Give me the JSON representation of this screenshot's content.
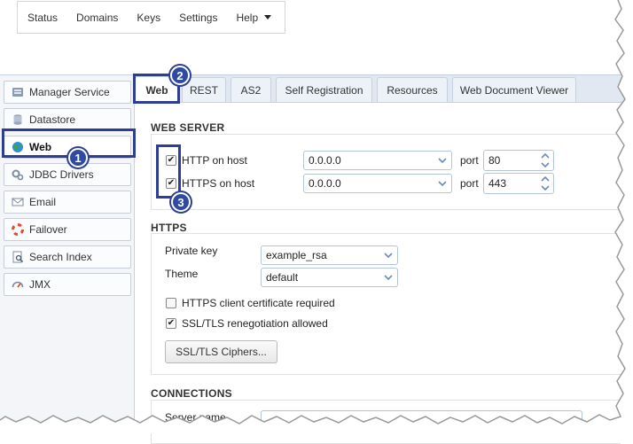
{
  "topmenu": {
    "items": [
      "Status",
      "Domains",
      "Keys",
      "Settings"
    ],
    "help_label": "Help"
  },
  "sidebar": {
    "items": [
      {
        "label": "Manager Service",
        "icon": "manager-service-icon"
      },
      {
        "label": "Datastore",
        "icon": "database-icon"
      },
      {
        "label": "Web",
        "icon": "globe-icon"
      },
      {
        "label": "JDBC Drivers",
        "icon": "gears-icon"
      },
      {
        "label": "Email",
        "icon": "envelope-icon"
      },
      {
        "label": "Failover",
        "icon": "lifebuoy-icon"
      },
      {
        "label": "Search Index",
        "icon": "search-index-icon"
      },
      {
        "label": "JMX",
        "icon": "gauge-icon"
      }
    ]
  },
  "tabs": [
    "Web",
    "REST",
    "AS2",
    "Self Registration",
    "Resources",
    "Web Document Viewer"
  ],
  "badges": [
    "1",
    "2",
    "3"
  ],
  "web_server": {
    "title": "WEB SERVER",
    "http_label": "HTTP on host",
    "http_host": "0.0.0.0",
    "http_port_label": "port",
    "http_port": "80",
    "http_checked": true,
    "https_label": "HTTPS on host",
    "https_host": "0.0.0.0",
    "https_port_label": "port",
    "https_port": "443",
    "https_checked": true
  },
  "https": {
    "title": "HTTPS",
    "private_key_label": "Private key",
    "private_key_value": "example_rsa",
    "theme_label": "Theme",
    "theme_value": "default",
    "client_cert_label": "HTTPS client certificate required",
    "client_cert_checked": false,
    "renegotiation_label": "SSL/TLS renegotiation allowed",
    "renegotiation_checked": true,
    "ciphers_button": "SSL/TLS Ciphers..."
  },
  "connections": {
    "title": "CONNECTIONS",
    "server_name_label": "Server name"
  },
  "colors": {
    "accent": "#2d3e95",
    "badge": "#2f4aa3",
    "tabbar": "#e1e8f2",
    "sidebar": "#f3f5f9"
  }
}
